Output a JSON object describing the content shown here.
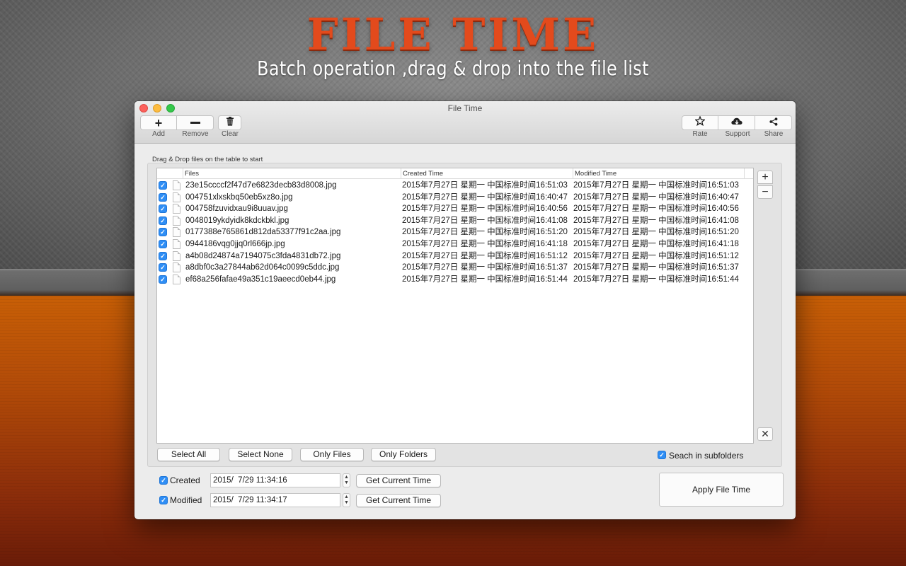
{
  "hero": {
    "title": "FILE TIME",
    "subtitle": "Batch operation ,drag & drop into the file list"
  },
  "window": {
    "title": "File Time"
  },
  "toolbar": {
    "add_label": "Add",
    "remove_label": "Remove",
    "clear_label": "Clear",
    "rate_label": "Rate",
    "support_label": "Support",
    "share_label": "Share"
  },
  "drag_hint": "Drag & Drop files on the table to start",
  "table": {
    "columns": [
      "Files",
      "Created Time",
      "Modified Time"
    ],
    "rows": [
      {
        "checked": true,
        "file": "23e15ccccf2f47d7e6823decb83d8008.jpg",
        "created": "2015年7月27日 星期一 中国标准时间16:51:03",
        "modified": "2015年7月27日 星期一 中国标准时间16:51:03"
      },
      {
        "checked": true,
        "file": "004751xlxskbq50eb5xz8o.jpg",
        "created": "2015年7月27日 星期一 中国标准时间16:40:47",
        "modified": "2015年7月27日 星期一 中国标准时间16:40:47"
      },
      {
        "checked": true,
        "file": "004758fzuvidxau9i8uuav.jpg",
        "created": "2015年7月27日 星期一 中国标准时间16:40:56",
        "modified": "2015年7月27日 星期一 中国标准时间16:40:56"
      },
      {
        "checked": true,
        "file": "0048019ykdyidk8kdckbkl.jpg",
        "created": "2015年7月27日 星期一 中国标准时间16:41:08",
        "modified": "2015年7月27日 星期一 中国标准时间16:41:08"
      },
      {
        "checked": true,
        "file": "0177388e765861d812da53377f91c2aa.jpg",
        "created": "2015年7月27日 星期一 中国标准时间16:51:20",
        "modified": "2015年7月27日 星期一 中国标准时间16:51:20"
      },
      {
        "checked": true,
        "file": "0944186vqg0jjq0rl666jp.jpg",
        "created": "2015年7月27日 星期一 中国标准时间16:41:18",
        "modified": "2015年7月27日 星期一 中国标准时间16:41:18"
      },
      {
        "checked": true,
        "file": "a4b08d24874a7194075c3fda4831db72.jpg",
        "created": "2015年7月27日 星期一 中国标准时间16:51:12",
        "modified": "2015年7月27日 星期一 中国标准时间16:51:12"
      },
      {
        "checked": true,
        "file": "a8dbf0c3a27844ab62d064c0099c5ddc.jpg",
        "created": "2015年7月27日 星期一 中国标准时间16:51:37",
        "modified": "2015年7月27日 星期一 中国标准时间16:51:37"
      },
      {
        "checked": true,
        "file": "ef68a256fafae49a351c19aeecd0eb44.jpg",
        "created": "2015年7月27日 星期一 中国标准时间16:51:44",
        "modified": "2015年7月27日 星期一 中国标准时间16:51:44"
      }
    ]
  },
  "selection_buttons": {
    "select_all": "Select All",
    "select_none": "Select None",
    "only_files": "Only Files",
    "only_folders": "Only Folders"
  },
  "subfolders": {
    "label": "Seach in subfolders",
    "checked": true
  },
  "created": {
    "label": "Created",
    "checked": true,
    "value": "2015/  7/29 11:34:16",
    "button": "Get Current Time"
  },
  "modified": {
    "label": "Modified",
    "checked": true,
    "value": "2015/  7/29 11:34:17",
    "button": "Get Current Time"
  },
  "apply_label": "Apply File Time",
  "colors": {
    "accent": "#2f8ef5",
    "hero_title": "#e34a1c",
    "background_bottom": "#b14a08"
  },
  "icons": {
    "add": "plus-icon",
    "remove": "minus-icon",
    "clear": "trash-icon",
    "rate": "star-icon",
    "support": "cloud-icon",
    "share": "share-icon",
    "file": "document-icon"
  }
}
